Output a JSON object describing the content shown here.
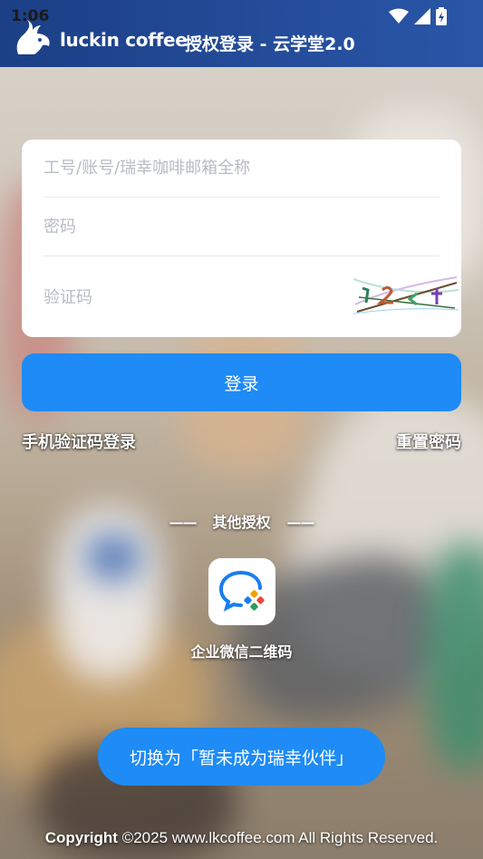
{
  "status_bar": {
    "time": "1:06",
    "icons": [
      "wifi-icon",
      "cell-signal-icon",
      "battery-icon"
    ]
  },
  "header": {
    "brand": "luckin coffee",
    "title": "授权登录 - 云学堂2.0",
    "logo_icon": "deer-logo-icon",
    "background_color": "#23489a"
  },
  "form": {
    "account_placeholder": "工号/账号/瑞幸咖啡邮箱全称",
    "account_value": "",
    "password_placeholder": "密码",
    "password_value": "",
    "captcha_placeholder": "验证码",
    "captcha_value": "",
    "captcha_icon": "captcha-image"
  },
  "actions": {
    "login_label": "登录",
    "sms_login_label": "手机验证码登录",
    "reset_password_label": "重置密码",
    "accent_color": "#1e8bf6"
  },
  "other_auth": {
    "title": "其他授权",
    "dash_left": "——",
    "dash_right": "——",
    "wework_label": "企业微信二维码",
    "wework_icon": "wework-icon"
  },
  "switch": {
    "label": "切换为「暂未成为瑞幸伙伴」"
  },
  "footer": {
    "copyright_bold": "Copyright",
    "copyright_rest": " ©2025 www.lkcoffee.com All Rights Reserved."
  }
}
